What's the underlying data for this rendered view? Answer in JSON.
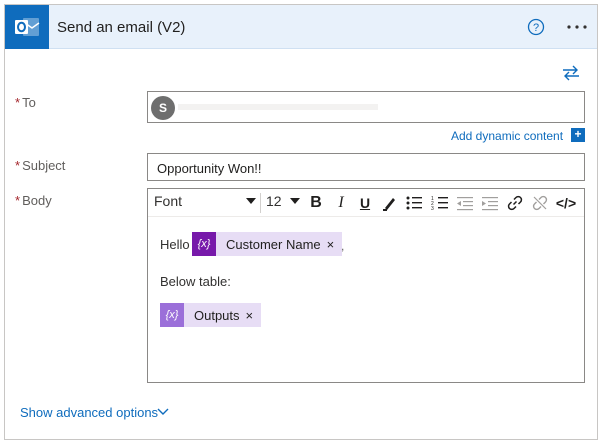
{
  "header": {
    "title": "Send an email (V2)",
    "logo_icon": "outlook-icon",
    "help_icon": "help-circle-icon",
    "more_icon": "more-ellipsis-icon",
    "background": "#e8f1fb",
    "brand_color": "#0f6cbd"
  },
  "fields": {
    "to": {
      "label": "To",
      "required_marker": "*",
      "avatar_initial": "S"
    },
    "dynamic_content": {
      "link": "Add dynamic content",
      "button": "+"
    },
    "subject": {
      "label": "Subject",
      "required_marker": "*",
      "value": "Opportunity Won!!"
    },
    "body": {
      "label": "Body",
      "required_marker": "*",
      "toolbar": {
        "font": "Font",
        "size": "12",
        "bold": "B",
        "italic": "I",
        "underline": "U",
        "code": "</>"
      },
      "content": {
        "hello": "Hello",
        "token1": {
          "icon_text": "{x}",
          "label": "Customer Name",
          "remove": "×"
        },
        "comma": ",",
        "below": "Below table:",
        "token2": {
          "icon_text": "{x}",
          "label": "Outputs",
          "remove": "×"
        }
      }
    }
  },
  "footer": {
    "advanced": "Show advanced options"
  },
  "colors": {
    "token_bg": "#e7ddf5",
    "token_icon": "#7719aa",
    "required": "#a4262c",
    "link": "#0f6cbd"
  }
}
